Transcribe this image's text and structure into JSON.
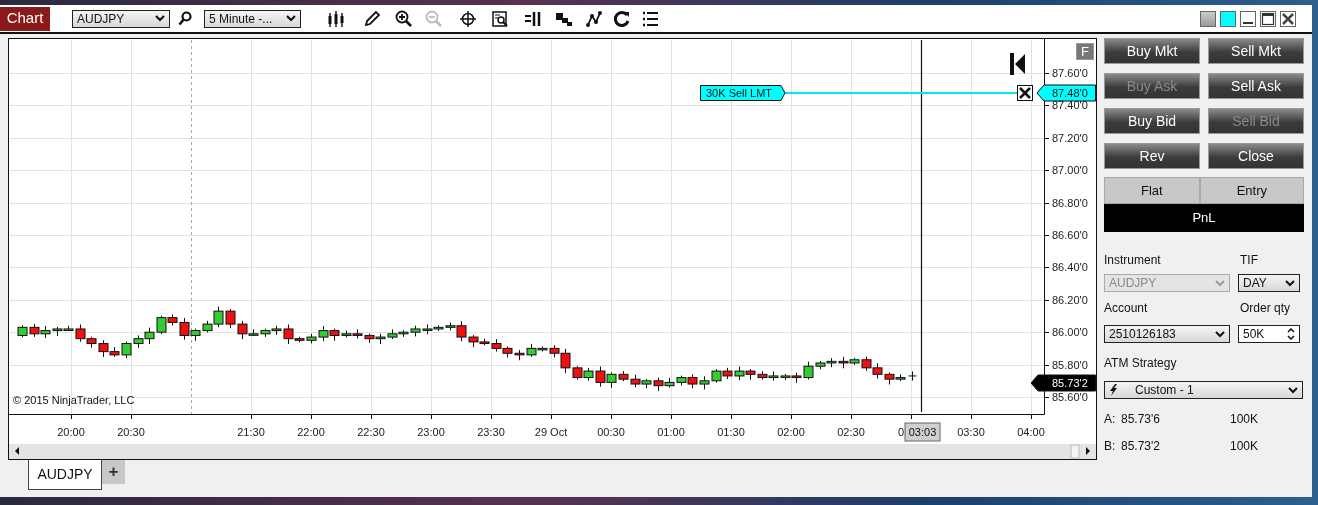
{
  "toolbar": {
    "title": "Chart",
    "instrument": "AUDJPY",
    "interval": "5 Minute -...",
    "tools": [
      {
        "kind": "bars",
        "disabled": false
      },
      {
        "kind": "pencil",
        "disabled": false
      },
      {
        "kind": "zoom-in",
        "disabled": false
      },
      {
        "kind": "zoom-out",
        "disabled": true
      },
      {
        "kind": "crosshair",
        "disabled": false
      },
      {
        "kind": "data-box",
        "disabled": false
      },
      {
        "kind": "bar-spacing",
        "disabled": false
      },
      {
        "kind": "squares",
        "disabled": false
      },
      {
        "kind": "nodes",
        "disabled": false
      },
      {
        "kind": "refresh",
        "disabled": false
      },
      {
        "kind": "list",
        "disabled": false
      }
    ]
  },
  "chart": {
    "price_labels": [
      "87.60'0",
      "87.40'0",
      "87.20'0",
      "87.00'0",
      "86.80'0",
      "86.60'0",
      "86.40'0",
      "86.20'0",
      "86.00'0",
      "85.80'0",
      "85.60'0"
    ],
    "time_labels": [
      "20:00",
      "20:30",
      "21:30",
      "22:00",
      "22:30",
      "23:00",
      "23:30",
      "29 Oct",
      "00:30",
      "01:00",
      "01:30",
      "02:00",
      "02:30",
      "0",
      "03:30",
      "04:00"
    ],
    "cursor_time": "03:03",
    "price_markers": [
      {
        "kind": "order",
        "text": "87.48'0"
      },
      {
        "kind": "last",
        "text": "85.73'2"
      }
    ],
    "order_tag": "30K  Sell LMT",
    "flat_button": "F",
    "copyright": "© 2015 NinjaTrader, LLC"
  },
  "order_buttons": [
    {
      "label": "Buy Mkt",
      "disabled": false
    },
    {
      "label": "Sell Mkt",
      "disabled": false
    },
    {
      "label": "Buy Ask",
      "disabled": true
    },
    {
      "label": "Sell Ask",
      "disabled": false
    },
    {
      "label": "Buy Bid",
      "disabled": false
    },
    {
      "label": "Sell Bid",
      "disabled": true
    },
    {
      "label": "Rev",
      "disabled": false
    },
    {
      "label": "Close",
      "disabled": false
    }
  ],
  "position": {
    "columns": [
      "Flat",
      "Entry"
    ],
    "pnl": "PnL"
  },
  "fields": {
    "instrument": {
      "label": "Instrument",
      "value": "AUDJPY",
      "disabled": true
    },
    "tif": {
      "label": "TIF",
      "value": "DAY"
    },
    "account": {
      "label": "Account",
      "value": "2510126183"
    },
    "quantity": {
      "label": "Order qty",
      "value": "50K"
    },
    "atm": {
      "label": "ATM Strategy",
      "value": "Custom - 1"
    }
  },
  "quotes": [
    {
      "side": "A:",
      "price": "85.73'6",
      "size": "100K"
    },
    {
      "side": "B:",
      "price": "85.73'2",
      "size": "100K"
    }
  ],
  "tabs": [
    {
      "label": "AUDJPY",
      "selected": true
    }
  ],
  "add_tab": "+"
}
